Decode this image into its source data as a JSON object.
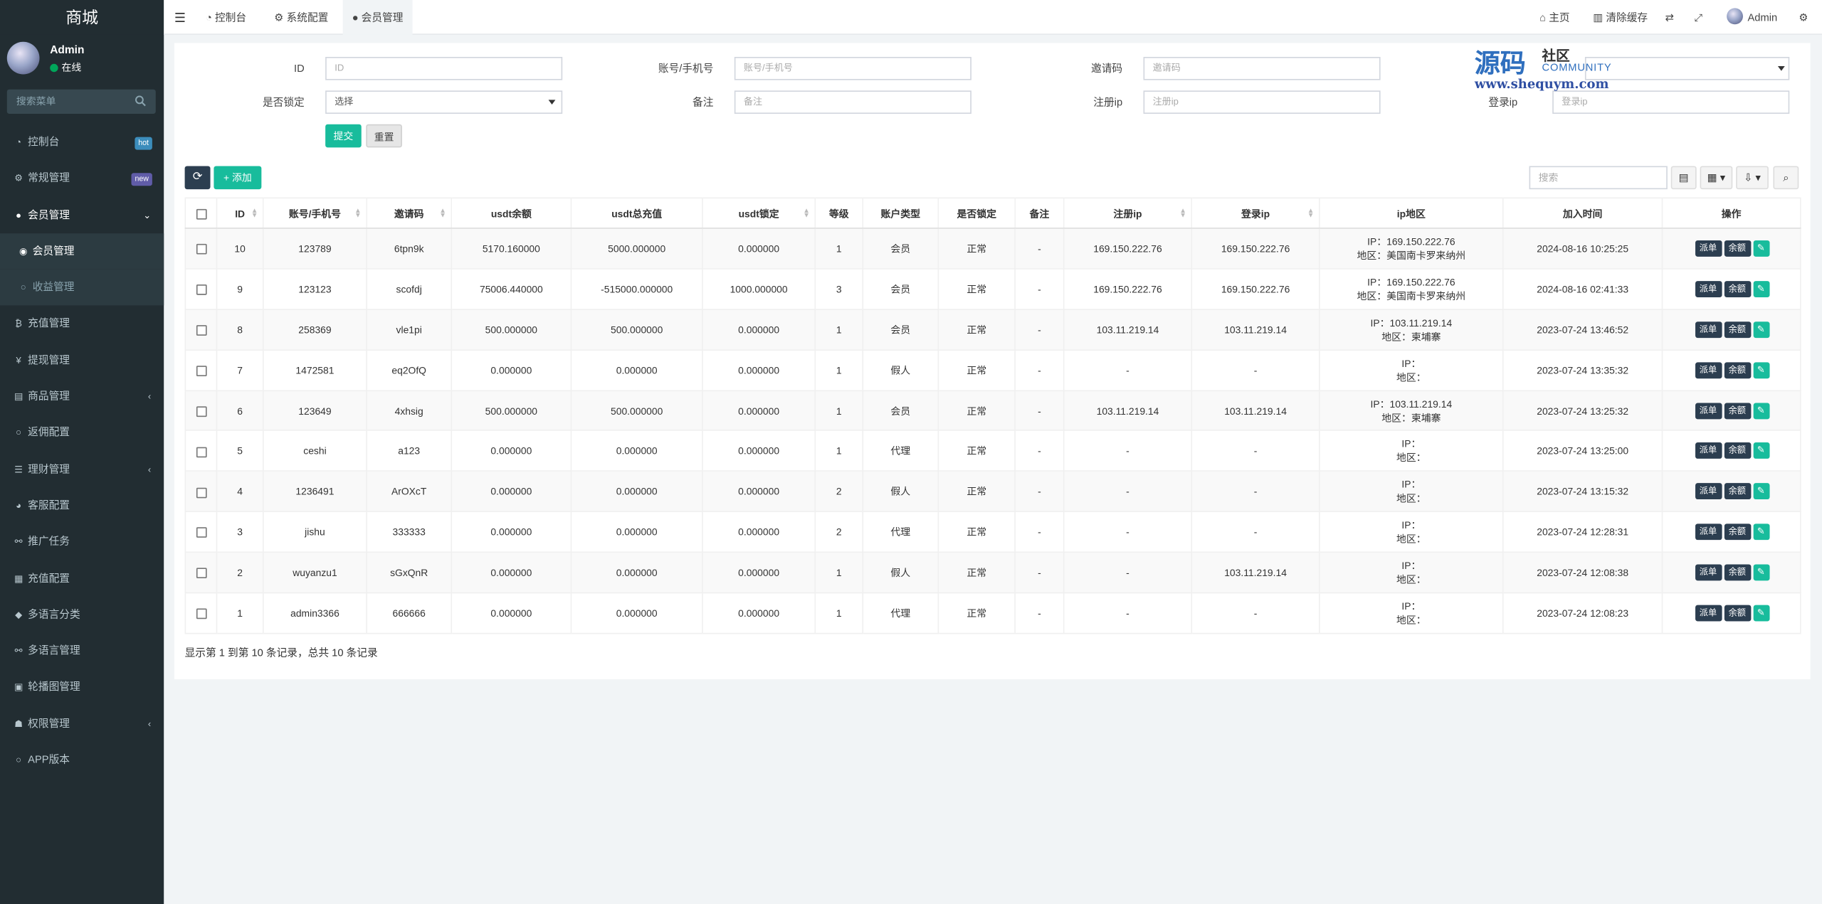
{
  "brand": "商城",
  "user": {
    "name": "Admin",
    "status": "在线"
  },
  "sidebar_search_placeholder": "搜索菜单",
  "menu": [
    {
      "label": "控制台",
      "icon": "dashboard-icon",
      "glyph": "◔",
      "badge": "hot",
      "badge_color": "#3c8dbc",
      "type": "item"
    },
    {
      "label": "常规管理",
      "icon": "cogs-icon",
      "glyph": "⚙",
      "badge": "new",
      "badge_color": "#605ca8",
      "type": "item"
    },
    {
      "label": "会员管理",
      "icon": "user-circle-icon",
      "glyph": "●",
      "arrow": "⌄",
      "type": "open"
    },
    {
      "label": "会员管理",
      "icon": "user-icon",
      "glyph": "◉",
      "type": "active-sub"
    },
    {
      "label": "收益管理",
      "icon": "circle-icon",
      "glyph": "○",
      "type": "sub"
    },
    {
      "label": "充值管理",
      "icon": "bitcoin-icon",
      "glyph": "₿",
      "type": "item"
    },
    {
      "label": "提现管理",
      "icon": "yen-icon",
      "glyph": "¥",
      "type": "item"
    },
    {
      "label": "商品管理",
      "icon": "cart-icon",
      "glyph": "▤",
      "arrow": "‹",
      "type": "item"
    },
    {
      "label": "返佣配置",
      "icon": "circle-icon",
      "glyph": "○",
      "type": "item"
    },
    {
      "label": "理财管理",
      "icon": "list-icon",
      "glyph": "☰",
      "arrow": "‹",
      "type": "item"
    },
    {
      "label": "客服配置",
      "icon": "gauge-icon",
      "glyph": "◕",
      "type": "item"
    },
    {
      "label": "推广任务",
      "icon": "link-icon",
      "glyph": "⚯",
      "type": "item"
    },
    {
      "label": "充值配置",
      "icon": "table-icon",
      "glyph": "▦",
      "type": "item"
    },
    {
      "label": "多语言分类",
      "icon": "tag-icon",
      "glyph": "◆",
      "type": "item"
    },
    {
      "label": "多语言管理",
      "icon": "link-icon",
      "glyph": "⚯",
      "type": "item"
    },
    {
      "label": "轮播图管理",
      "icon": "image-icon",
      "glyph": "▣",
      "type": "item"
    },
    {
      "label": "权限管理",
      "icon": "group-icon",
      "glyph": "☗",
      "arrow": "‹",
      "type": "item"
    },
    {
      "label": "APP版本",
      "icon": "circle-icon",
      "glyph": "○",
      "type": "item"
    }
  ],
  "topbar": {
    "tabs": [
      {
        "label": "控制台",
        "glyph": "◔"
      },
      {
        "label": "系统配置",
        "glyph": "⚙"
      },
      {
        "label": "会员管理",
        "glyph": "●"
      }
    ],
    "home": "主页",
    "clear_cache": "清除缓存",
    "admin": "Admin"
  },
  "filters": {
    "id": {
      "label": "ID",
      "placeholder": "ID"
    },
    "account": {
      "label": "账号/手机号",
      "placeholder": "账号/手机号"
    },
    "invite": {
      "label": "邀请码",
      "placeholder": "邀请码"
    },
    "type_select": "",
    "locked": {
      "label": "是否锁定",
      "value": "选择"
    },
    "remark": {
      "label": "备注",
      "placeholder": "备注"
    },
    "reg_ip": {
      "label": "注册ip",
      "placeholder": "注册ip"
    },
    "login_ip": {
      "label": "登录ip",
      "placeholder": "登录ip"
    },
    "submit": "提交",
    "reset": "重置"
  },
  "watermark": {
    "big": "源码",
    "small": "社区",
    "community": "COMMUNITY",
    "url": "www.shequym.com"
  },
  "toolbar": {
    "add": "添加",
    "search_placeholder": "搜索"
  },
  "table": {
    "headers": [
      "ID",
      "账号/手机号",
      "邀请码",
      "usdt余额",
      "usdt总充值",
      "usdt锁定",
      "等级",
      "账户类型",
      "是否锁定",
      "备注",
      "注册ip",
      "登录ip",
      "ip地区",
      "加入时间",
      "操作"
    ],
    "ip_prefix": "IP：",
    "area_prefix": "地区：",
    "btn_order": "派单",
    "btn_balance": "余额",
    "rows": [
      {
        "id": "10",
        "account": "123789",
        "invite": "6tpn9k",
        "balance": "5170.160000",
        "total": "5000.000000",
        "locked_amt": "0.000000",
        "level": "1",
        "type": "会员",
        "lock": "正常",
        "remark": "-",
        "reg_ip": "169.150.222.76",
        "login_ip": "169.150.222.76",
        "ip": "169.150.222.76",
        "area": "美国南卡罗来纳州",
        "time": "2024-08-16 10:25:25"
      },
      {
        "id": "9",
        "account": "123123",
        "invite": "scofdj",
        "balance": "75006.440000",
        "total": "-515000.000000",
        "locked_amt": "1000.000000",
        "level": "3",
        "type": "会员",
        "lock": "正常",
        "remark": "-",
        "reg_ip": "169.150.222.76",
        "login_ip": "169.150.222.76",
        "ip": "169.150.222.76",
        "area": "美国南卡罗来纳州",
        "time": "2024-08-16 02:41:33"
      },
      {
        "id": "8",
        "account": "258369",
        "invite": "vle1pi",
        "balance": "500.000000",
        "total": "500.000000",
        "locked_amt": "0.000000",
        "level": "1",
        "type": "会员",
        "lock": "正常",
        "remark": "-",
        "reg_ip": "103.11.219.14",
        "login_ip": "103.11.219.14",
        "ip": "103.11.219.14",
        "area": "柬埔寨",
        "time": "2023-07-24 13:46:52"
      },
      {
        "id": "7",
        "account": "1472581",
        "invite": "eq2OfQ",
        "balance": "0.000000",
        "total": "0.000000",
        "locked_amt": "0.000000",
        "level": "1",
        "type": "假人",
        "lock": "正常",
        "remark": "-",
        "reg_ip": "-",
        "login_ip": "-",
        "ip": "",
        "area": "",
        "time": "2023-07-24 13:35:32"
      },
      {
        "id": "6",
        "account": "123649",
        "invite": "4xhsig",
        "balance": "500.000000",
        "total": "500.000000",
        "locked_amt": "0.000000",
        "level": "1",
        "type": "会员",
        "lock": "正常",
        "remark": "-",
        "reg_ip": "103.11.219.14",
        "login_ip": "103.11.219.14",
        "ip": "103.11.219.14",
        "area": "柬埔寨",
        "time": "2023-07-24 13:25:32"
      },
      {
        "id": "5",
        "account": "ceshi",
        "invite": "a123",
        "balance": "0.000000",
        "total": "0.000000",
        "locked_amt": "0.000000",
        "level": "1",
        "type": "代理",
        "lock": "正常",
        "remark": "-",
        "reg_ip": "-",
        "login_ip": "-",
        "ip": "",
        "area": "",
        "time": "2023-07-24 13:25:00"
      },
      {
        "id": "4",
        "account": "1236491",
        "invite": "ArOXcT",
        "balance": "0.000000",
        "total": "0.000000",
        "locked_amt": "0.000000",
        "level": "2",
        "type": "假人",
        "lock": "正常",
        "remark": "-",
        "reg_ip": "-",
        "login_ip": "-",
        "ip": "",
        "area": "",
        "time": "2023-07-24 13:15:32"
      },
      {
        "id": "3",
        "account": "jishu",
        "invite": "333333",
        "balance": "0.000000",
        "total": "0.000000",
        "locked_amt": "0.000000",
        "level": "2",
        "type": "代理",
        "lock": "正常",
        "remark": "-",
        "reg_ip": "-",
        "login_ip": "-",
        "ip": "",
        "area": "",
        "time": "2023-07-24 12:28:31"
      },
      {
        "id": "2",
        "account": "wuyanzu1",
        "invite": "sGxQnR",
        "balance": "0.000000",
        "total": "0.000000",
        "locked_amt": "0.000000",
        "level": "1",
        "type": "假人",
        "lock": "正常",
        "remark": "-",
        "reg_ip": "-",
        "login_ip": "103.11.219.14",
        "ip": "",
        "area": "",
        "time": "2023-07-24 12:08:38"
      },
      {
        "id": "1",
        "account": "admin3366",
        "invite": "666666",
        "balance": "0.000000",
        "total": "0.000000",
        "locked_amt": "0.000000",
        "level": "1",
        "type": "代理",
        "lock": "正常",
        "remark": "-",
        "reg_ip": "-",
        "login_ip": "-",
        "ip": "",
        "area": "",
        "time": "2023-07-24 12:08:23"
      }
    ]
  },
  "footer": "显示第 1 到第 10 条记录，总共 10 条记录"
}
